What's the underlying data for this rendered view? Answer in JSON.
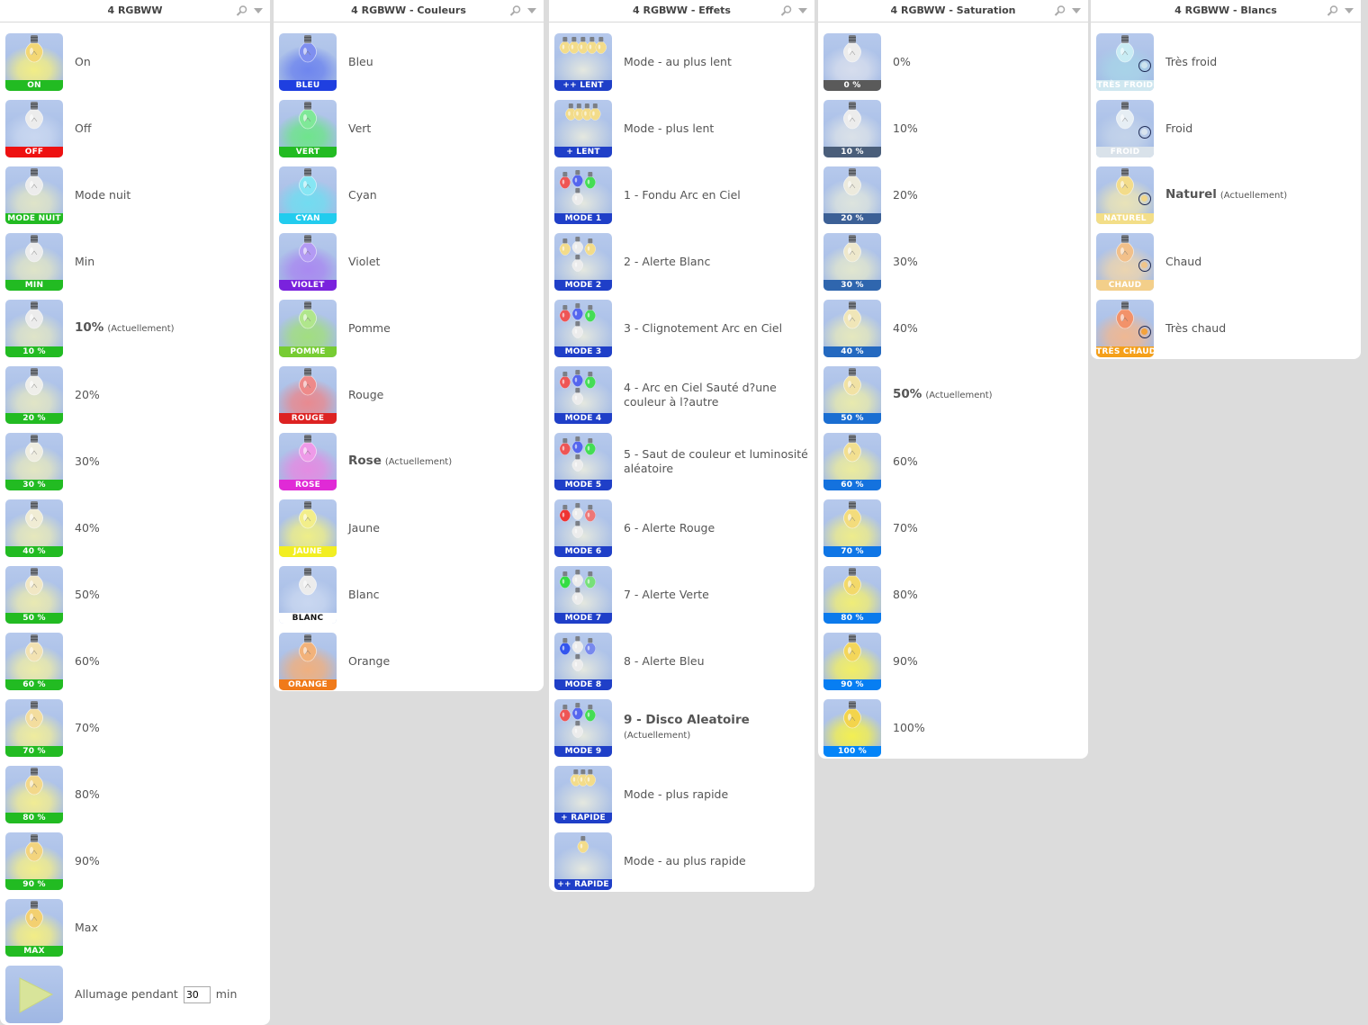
{
  "colors": {
    "green": "#22bb22",
    "red": "#ee1111",
    "blue": "#1f3fc8",
    "bg": "#dcdcdc"
  },
  "panels": [
    {
      "title": "4 RGBWW",
      "items": [
        {
          "tag": "ON",
          "label": "On",
          "band": "#22bb22",
          "glow": "#f2ed86",
          "bulb": "#f3d775"
        },
        {
          "tag": "OFF",
          "label": "Off",
          "band": "#ee1111",
          "glow": "#c9d7f0",
          "bulb": "#ececec"
        },
        {
          "tag": "MODE NUIT",
          "label": "Mode nuit",
          "band": "#22bb22",
          "glow": "#dfe4c8",
          "bulb": "#ececec"
        },
        {
          "tag": "MIN",
          "label": "Min",
          "band": "#22bb22",
          "glow": "#dfe4c8",
          "bulb": "#ececec"
        },
        {
          "tag": "10 %",
          "label": "10%",
          "band": "#22bb22",
          "glow": "#dfe4c8",
          "bulb": "#ececec",
          "current": true,
          "current_note": "(Actuellement)"
        },
        {
          "tag": "20 %",
          "label": "20%",
          "band": "#22bb22",
          "glow": "#e1e5c6",
          "bulb": "#eeeeea"
        },
        {
          "tag": "30 %",
          "label": "30%",
          "band": "#22bb22",
          "glow": "#e3e6c2",
          "bulb": "#efede0"
        },
        {
          "tag": "40 %",
          "label": "40%",
          "band": "#22bb22",
          "glow": "#e6e8bc",
          "bulb": "#f0ecd4"
        },
        {
          "tag": "50 %",
          "label": "50%",
          "band": "#22bb22",
          "glow": "#e9e9b2",
          "bulb": "#f1e7c4"
        },
        {
          "tag": "60 %",
          "label": "60%",
          "band": "#22bb22",
          "glow": "#ecebaa",
          "bulb": "#f2e2b2"
        },
        {
          "tag": "70 %",
          "label": "70%",
          "band": "#22bb22",
          "glow": "#efec9e",
          "bulb": "#f3dd9e"
        },
        {
          "tag": "80 %",
          "label": "80%",
          "band": "#22bb22",
          "glow": "#f1ec94",
          "bulb": "#f3d88a"
        },
        {
          "tag": "90 %",
          "label": "90%",
          "band": "#22bb22",
          "glow": "#f2ed8c",
          "bulb": "#f3d47e"
        },
        {
          "tag": "MAX",
          "label": "Max",
          "band": "#22bb22",
          "glow": "#f2ed86",
          "bulb": "#f3d070"
        }
      ],
      "timer": {
        "prefix": "Allumage pendant",
        "value": "30",
        "suffix": "min"
      }
    },
    {
      "title": "4 RGBWW - Couleurs",
      "items": [
        {
          "tag": "BLEU",
          "label": "Bleu",
          "band": "#1f3fe0",
          "glow": "#6f86ee",
          "bulb": "#7f8ff0"
        },
        {
          "tag": "VERT",
          "label": "Vert",
          "band": "#22bb22",
          "glow": "#6fe48c",
          "bulb": "#7fe898"
        },
        {
          "tag": "CYAN",
          "label": "Cyan",
          "band": "#22ccee",
          "glow": "#72dcf0",
          "bulb": "#86e6f4"
        },
        {
          "tag": "VIOLET",
          "label": "Violet",
          "band": "#7a22dd",
          "glow": "#a98af0",
          "bulb": "#b39af4"
        },
        {
          "tag": "POMME",
          "label": "Pomme",
          "band": "#77cc33",
          "glow": "#a2de80",
          "bulb": "#b0e68c"
        },
        {
          "tag": "ROUGE",
          "label": "Rouge",
          "band": "#dd2222",
          "glow": "#e88a90",
          "bulb": "#ee8a8a"
        },
        {
          "tag": "ROSE",
          "label": "Rose",
          "band": "#e02ad6",
          "glow": "#e38ce2",
          "bulb": "#ee9ae8",
          "current": true,
          "current_note": "(Actuellement)"
        },
        {
          "tag": "JAUNE",
          "label": "Jaune",
          "band": "#f2ee22",
          "glow": "#eeee88",
          "bulb": "#f2ee8a"
        },
        {
          "tag": "BLANC",
          "label": "Blanc",
          "band": "#ffffff",
          "glow": "#c9d7f0",
          "bulb": "#ececec",
          "dark_text": true
        },
        {
          "tag": "ORANGE",
          "label": "Orange",
          "band": "#f07a1a",
          "glow": "#efb080",
          "bulb": "#f2b27a"
        }
      ]
    },
    {
      "title": "4 RGBWW - Effets",
      "items": [
        {
          "tag": "++ LENT",
          "label": "Mode - au plus lent",
          "band": "#1f3fc8",
          "pattern": "slow5"
        },
        {
          "tag": "+ LENT",
          "label": "Mode - plus lent",
          "band": "#1f3fc8",
          "pattern": "slow4"
        },
        {
          "tag": "MODE 1",
          "label": "1 - Fondu Arc en Ciel",
          "band": "#1f3fc8",
          "pattern": "rgb"
        },
        {
          "tag": "MODE 2",
          "label": "2 - Alerte Blanc",
          "band": "#1f3fc8",
          "pattern": "white"
        },
        {
          "tag": "MODE 3",
          "label": "3 - Clignotement Arc en Ciel",
          "band": "#1f3fc8",
          "pattern": "rgb"
        },
        {
          "tag": "MODE 4",
          "label": "4 - Arc en Ciel Sauté d?une couleur à l?autre",
          "band": "#1f3fc8",
          "pattern": "rgb"
        },
        {
          "tag": "MODE 5",
          "label": "5 - Saut de couleur et luminosité aléatoire",
          "band": "#1f3fc8",
          "pattern": "rgb"
        },
        {
          "tag": "MODE 6",
          "label": "6 - Alerte Rouge",
          "band": "#1f3fc8",
          "pattern": "red"
        },
        {
          "tag": "MODE 7",
          "label": "7 - Alerte Verte",
          "band": "#1f3fc8",
          "pattern": "green"
        },
        {
          "tag": "MODE 8",
          "label": "8 - Alerte Bleu",
          "band": "#1f3fc8",
          "pattern": "blue"
        },
        {
          "tag": "MODE 9",
          "label": "9 - Disco Aleatoire",
          "band": "#1f3fc8",
          "pattern": "rgb",
          "current": true,
          "current_note": "(Actuellement)"
        },
        {
          "tag": "+ RAPIDE",
          "label": "Mode - plus rapide",
          "band": "#1f3fc8",
          "pattern": "fast3"
        },
        {
          "tag": "++ RAPIDE",
          "label": "Mode - au plus rapide",
          "band": "#1f3fc8",
          "pattern": "fast1"
        }
      ]
    },
    {
      "title": "4 RGBWW - Saturation",
      "items": [
        {
          "tag": "0 %",
          "label": "0%",
          "band": "#5a5a5a",
          "glow": "#d6dded",
          "bulb": "#ececec"
        },
        {
          "tag": "10 %",
          "label": "10%",
          "band": "#4a5e7a",
          "glow": "#dae1e8",
          "bulb": "#ececec"
        },
        {
          "tag": "20 %",
          "label": "20%",
          "band": "#3c6096",
          "glow": "#dde4de",
          "bulb": "#eceadd"
        },
        {
          "tag": "30 %",
          "label": "30%",
          "band": "#2f66ae",
          "glow": "#e1e6cf",
          "bulb": "#eee8cc"
        },
        {
          "tag": "40 %",
          "label": "40%",
          "band": "#2469c0",
          "glow": "#e5e8be",
          "bulb": "#f0e6b8"
        },
        {
          "tag": "50 %",
          "label": "50%",
          "band": "#1a6ed2",
          "glow": "#e8eaae",
          "bulb": "#f1e2a4",
          "current": true,
          "current_note": "(Actuellement)"
        },
        {
          "tag": "60 %",
          "label": "60%",
          "band": "#1472de",
          "glow": "#ebeb9e",
          "bulb": "#f2df90"
        },
        {
          "tag": "70 %",
          "label": "70%",
          "band": "#0f76e6",
          "glow": "#eeec8c",
          "bulb": "#f3dc7c"
        },
        {
          "tag": "80 %",
          "label": "80%",
          "band": "#0b7aec",
          "glow": "#f0ed78",
          "bulb": "#f3d96a"
        },
        {
          "tag": "90 %",
          "label": "90%",
          "band": "#077ef2",
          "glow": "#f2ee66",
          "bulb": "#f3d65a"
        },
        {
          "tag": "100 %",
          "label": "100%",
          "band": "#0384f8",
          "glow": "#f3ef52",
          "bulb": "#f3d44c"
        }
      ]
    },
    {
      "title": "4 RGBWW - Blancs",
      "items": [
        {
          "tag": "TRÈS FROID",
          "label": "Très froid",
          "band": "#cfe7f0",
          "glow": "#a8d3e8",
          "bulb": "#c9ecf4",
          "ring": "#cde3ee"
        },
        {
          "tag": "FROID",
          "label": "Froid",
          "band": "#d9e2ea",
          "glow": "#c3d3ea",
          "bulb": "#e6eef4",
          "ring": "#d9e4ee"
        },
        {
          "tag": "NATUREL",
          "label": "Naturel",
          "band": "#f3de88",
          "glow": "#e9e3b8",
          "bulb": "#f3dc8a",
          "ring": "#f1d68a",
          "current": true,
          "current_note": "(Actuellement)"
        },
        {
          "tag": "CHAUD",
          "label": "Chaud",
          "band": "#f3cf8a",
          "glow": "#ebd4b0",
          "bulb": "#f2c08a",
          "ring": "#f0c58a"
        },
        {
          "tag": "TRÈS CHAUD",
          "label": "Très chaud",
          "band": "#f5a01a",
          "glow": "#efb893",
          "bulb": "#f2926a",
          "ring": "#f4a23a"
        }
      ]
    }
  ]
}
